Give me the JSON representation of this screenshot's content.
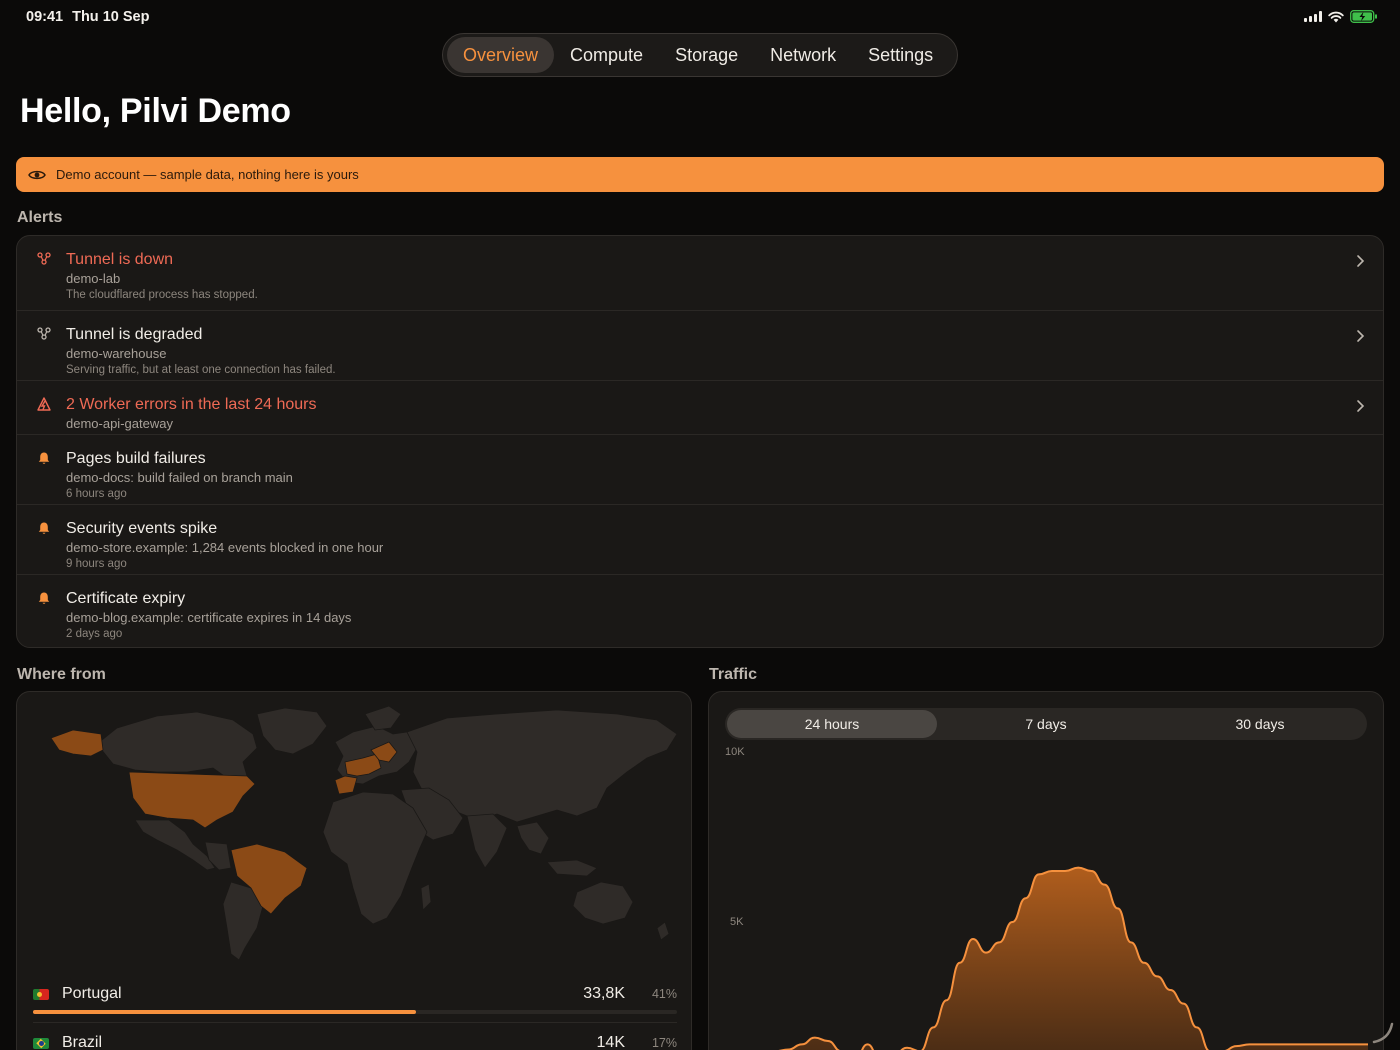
{
  "status_bar": {
    "time": "09:41",
    "date": "Thu 10 Sep",
    "icons": [
      "signal-icon",
      "wifi-icon",
      "battery-charging-icon"
    ]
  },
  "tabs": [
    {
      "label": "Overview",
      "active": true
    },
    {
      "label": "Compute",
      "active": false
    },
    {
      "label": "Storage",
      "active": false
    },
    {
      "label": "Network",
      "active": false
    },
    {
      "label": "Settings",
      "active": false
    }
  ],
  "greeting": "Hello, Pilvi Demo",
  "banner": {
    "text": "Demo account — sample data, nothing here is yours",
    "icon": "eye-icon",
    "color": "#f6913e"
  },
  "alerts": {
    "title": "Alerts",
    "items": [
      {
        "title": "Tunnel is down",
        "subtitle": "demo-lab",
        "detail": "The cloudflared process has stopped.",
        "icon": "tunnel-icon",
        "severity": "red",
        "chevron": true
      },
      {
        "title": "Tunnel is degraded",
        "subtitle": "demo-warehouse",
        "detail": "Serving traffic, but at least one connection has failed.",
        "icon": "tunnel-icon",
        "severity": "normal",
        "chevron": true
      },
      {
        "title": "2 Worker errors in the last 24 hours",
        "subtitle": "demo-api-gateway",
        "detail": "",
        "icon": "worker-error-icon",
        "severity": "red",
        "chevron": true
      },
      {
        "title": "Pages build failures",
        "subtitle": "demo-docs: build failed on branch main",
        "detail": "6 hours ago",
        "icon": "bell-icon",
        "severity": "normal",
        "chevron": false
      },
      {
        "title": "Security events spike",
        "subtitle": "demo-store.example: 1,284 events blocked in one hour",
        "detail": "9 hours ago",
        "icon": "bell-icon",
        "severity": "normal",
        "chevron": false
      },
      {
        "title": "Certificate expiry",
        "subtitle": "demo-blog.example: certificate expires in 14 days",
        "detail": "2 days ago",
        "icon": "bell-icon",
        "severity": "normal",
        "chevron": false
      }
    ]
  },
  "where_from": {
    "title": "Where from",
    "countries": [
      {
        "name": "Portugal",
        "count": "33,8K",
        "percent": "41%",
        "share": 0.41,
        "flag": "portugal-flag-icon"
      },
      {
        "name": "Brazil",
        "count": "14K",
        "percent": "17%",
        "share": 0.17,
        "flag": "brazil-flag-icon"
      }
    ]
  },
  "traffic": {
    "title": "Traffic",
    "ranges": [
      {
        "label": "24 hours",
        "active": true
      },
      {
        "label": "7 days",
        "active": false
      },
      {
        "label": "30 days",
        "active": false
      }
    ],
    "chart_data": {
      "type": "area",
      "y_ticks": [
        "10K",
        "5K"
      ],
      "ylim": [
        0,
        10000
      ],
      "x": [
        0,
        1,
        2,
        3,
        4,
        5,
        6,
        7,
        8,
        9,
        10,
        11,
        12,
        13,
        14,
        15,
        16,
        17,
        18,
        19,
        20,
        21,
        22,
        23,
        24,
        25,
        26,
        27,
        28,
        29,
        30,
        31,
        32,
        33,
        34,
        35,
        36,
        37,
        38,
        39,
        40,
        41,
        42,
        43,
        44,
        45,
        46,
        47
      ],
      "values": [
        1200,
        1200,
        1200,
        1250,
        1400,
        1600,
        1500,
        1200,
        900,
        1400,
        900,
        1100,
        1300,
        1200,
        1900,
        2700,
        3800,
        4500,
        4100,
        4400,
        5000,
        5700,
        6400,
        6500,
        6500,
        6600,
        6500,
        6100,
        5400,
        4400,
        3800,
        3400,
        3000,
        2600,
        1900,
        1200,
        1200,
        1350,
        1400,
        1400,
        1400,
        1400,
        1400,
        1400,
        1400,
        1400,
        1400,
        1400
      ]
    },
    "accent": "#f6913e"
  }
}
